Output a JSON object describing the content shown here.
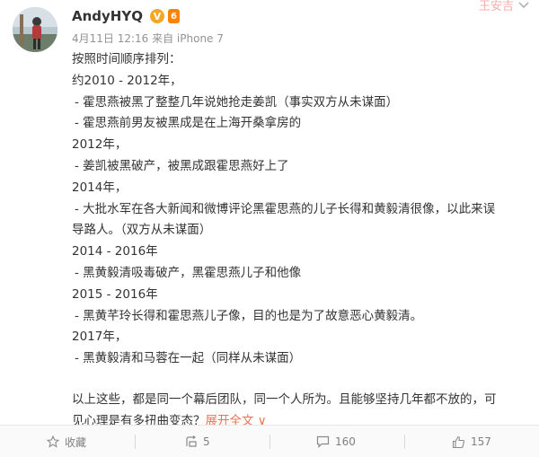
{
  "post": {
    "username": "AndyHYQ",
    "verified_badge": "V",
    "vip_badge": "6",
    "meta": "4月11日 12:16 来自 iPhone 7",
    "top_right_text": "王安吉",
    "lines": [
      "按照时间顺序排列：",
      "约2010 - 2012年，",
      " - 霍思燕被黑了整整几年说她抢走姜凯（事实双方从未谋面）",
      " - 霍思燕前男友被黑成是在上海开桑拿房的",
      "2012年，",
      " - 姜凯被黑破产，被黑成跟霍思燕好上了",
      "2014年，",
      " - 大批水军在各大新闻和微博评论黑霍思燕的儿子长得和黄毅清很像，以此来误",
      "导路人。（双方从未谋面）",
      "2014 - 2016年",
      " - 黑黄毅清吸毒破产，黑霍思燕儿子和他像",
      "2015 - 2016年",
      " - 黑黄芊玲长得和霍思燕儿子像，目的也是为了故意恶心黄毅清。",
      "2017年，",
      " - 黑黄毅清和马蓉在一起（同样从未谋面）"
    ],
    "closing_1": "以上这些，都是同一个幕后团队，同一个人所为。且能够坚持几年都不放的，可",
    "closing_2": "见心理是有多扭曲变态？",
    "expand_label": "展开全文 ∨"
  },
  "actions": {
    "favorite_label": "收藏",
    "repost_count": "5",
    "comment_count": "160",
    "like_count": "157"
  },
  "colors": {
    "text": "#333333",
    "meta": "#939393",
    "link": "#eb7350",
    "verified": "#f6a623",
    "vip": "#ff8200"
  }
}
